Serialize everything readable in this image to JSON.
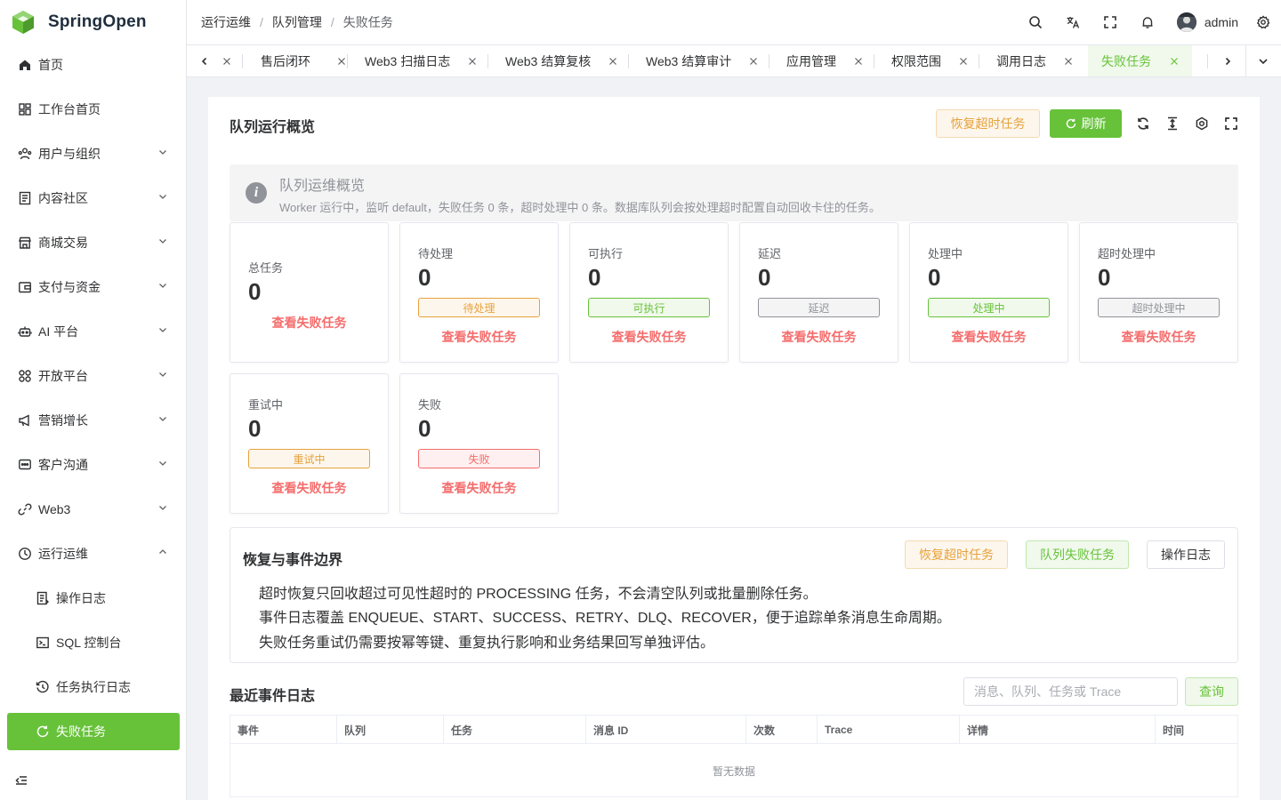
{
  "app": {
    "name": "SpringOpen"
  },
  "sidebar": {
    "items": [
      {
        "label": "首页",
        "icon": "home-icon"
      },
      {
        "label": "工作台首页",
        "icon": "dashboard-icon"
      },
      {
        "label": "用户与组织",
        "icon": "users-icon"
      },
      {
        "label": "内容社区",
        "icon": "document-icon"
      },
      {
        "label": "商城交易",
        "icon": "shop-icon"
      },
      {
        "label": "支付与资金",
        "icon": "wallet-icon"
      },
      {
        "label": "AI 平台",
        "icon": "robot-icon"
      },
      {
        "label": "开放平台",
        "icon": "apps-icon"
      },
      {
        "label": "营销增长",
        "icon": "megaphone-icon"
      },
      {
        "label": "客户沟通",
        "icon": "chat-icon"
      },
      {
        "label": "Web3",
        "icon": "link-icon"
      },
      {
        "label": "运行运维",
        "icon": "monitor-icon"
      }
    ],
    "sub_items": [
      {
        "label": "操作日志",
        "icon": "log-icon"
      },
      {
        "label": "SQL 控制台",
        "icon": "terminal-icon"
      },
      {
        "label": "任务执行日志",
        "icon": "history-icon"
      },
      {
        "label": "失败任务",
        "icon": "refresh-icon"
      }
    ]
  },
  "header": {
    "breadcrumb": [
      "运行运维",
      "队列管理",
      "失败任务"
    ],
    "username": "admin"
  },
  "tabs": [
    "售后闭环",
    "Web3 扫描日志",
    "Web3 结算复核",
    "Web3 结算审计",
    "应用管理",
    "权限范围",
    "调用日志",
    "失败任务"
  ],
  "page": {
    "title": "队列运行概览",
    "buttons": {
      "recover": "恢复超时任务",
      "refresh": "刷新"
    },
    "alert": {
      "title": "队列运维概览",
      "description": "Worker 运行中，监听 default，失败任务 0 条，超时处理中 0 条。数据库队列会按处理超时配置自动回收卡住的任务。"
    },
    "stats": [
      {
        "label": "总任务",
        "value": "0",
        "tag": "",
        "link": "查看失败任务"
      },
      {
        "label": "待处理",
        "value": "0",
        "tag": "待处理",
        "tag_type": "warning",
        "link": "查看失败任务"
      },
      {
        "label": "可执行",
        "value": "0",
        "tag": "可执行",
        "tag_type": "success",
        "link": "查看失败任务"
      },
      {
        "label": "延迟",
        "value": "0",
        "tag": "延迟",
        "tag_type": "info",
        "link": "查看失败任务"
      },
      {
        "label": "处理中",
        "value": "0",
        "tag": "处理中",
        "tag_type": "success",
        "link": "查看失败任务"
      },
      {
        "label": "超时处理中",
        "value": "0",
        "tag": "超时处理中",
        "tag_type": "info",
        "link": "查看失败任务"
      },
      {
        "label": "重试中",
        "value": "0",
        "tag": "重试中",
        "tag_type": "warning",
        "link": "查看失败任务"
      },
      {
        "label": "失败",
        "value": "0",
        "tag": "失败",
        "tag_type": "danger",
        "link": "查看失败任务"
      }
    ],
    "boundary": {
      "title": "恢复与事件边界",
      "buttons": {
        "recover": "恢复超时任务",
        "failed": "队列失败任务",
        "oplog": "操作日志"
      },
      "lines": [
        "超时恢复只回收超过可见性超时的 PROCESSING 任务，不会清空队列或批量删除任务。",
        "事件日志覆盖 ENQUEUE、START、SUCCESS、RETRY、DLQ、RECOVER，便于追踪单条消息生命周期。",
        "失败任务重试仍需要按幂等键、重复执行影响和业务结果回写单独评估。"
      ]
    },
    "events": {
      "title": "最近事件日志",
      "search_placeholder": "消息、队列、任务或 Trace",
      "query": "查询",
      "columns": [
        "事件",
        "队列",
        "任务",
        "消息 ID",
        "次数",
        "Trace",
        "详情",
        "时间"
      ],
      "empty_text": "暂无数据"
    }
  },
  "colors": {
    "primary": "#67c23a",
    "warning": "#e6a23c",
    "danger": "#f56c6c",
    "info": "#909399"
  }
}
